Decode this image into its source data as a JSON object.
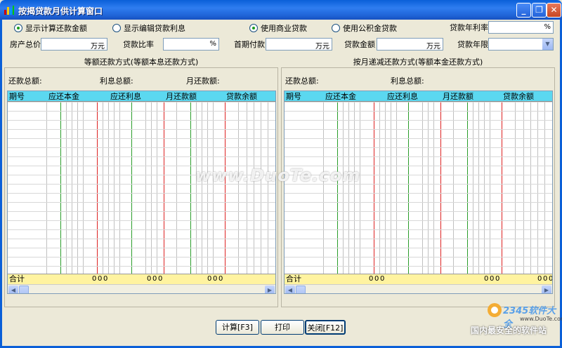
{
  "window": {
    "title": "按揭贷款月供计算窗口"
  },
  "options": {
    "show_total": "显示计算还款金额",
    "show_edit": "显示编辑贷款利息",
    "commercial": "使用商业贷款",
    "provident": "使用公积金贷款"
  },
  "fields": {
    "annual_rate_label": "贷款年利率",
    "annual_rate_unit": "%",
    "house_price_label": "房产总价",
    "house_price_unit": "万元",
    "loan_ratio_label": "贷款比率",
    "loan_ratio_unit": "%",
    "down_payment_label": "首期付款",
    "down_payment_unit": "万元",
    "loan_amount_label": "贷款金额",
    "loan_amount_unit": "万元",
    "loan_term_label": "贷款年限"
  },
  "left_panel": {
    "title": "等额还款方式(等额本息还款方式)",
    "total_repay": "还款总额:",
    "total_interest": "利息总额:",
    "monthly": "月还款额:",
    "columns": [
      "期号",
      "应还本金",
      "应还利息",
      "月还款额",
      "贷款余额"
    ],
    "footer": "合计",
    "zeros": [
      "0",
      "0",
      "0",
      "0",
      "0",
      "0",
      "0",
      "0",
      "0"
    ]
  },
  "right_panel": {
    "title": "按月递减还款方式(等额本金还款方式)",
    "total_repay": "还款总额:",
    "total_interest": "利息总额:",
    "columns": [
      "期号",
      "应还本金",
      "应还利息",
      "月还款额",
      "贷款余额"
    ],
    "footer": "合计",
    "zeros": [
      "0",
      "0",
      "0",
      "0",
      "0",
      "0",
      "0",
      "0",
      "0"
    ]
  },
  "buttons": {
    "calc": "计算[F3]",
    "print": "打印",
    "close": "关闭[F12]"
  },
  "watermark": {
    "text": "www.DuoTe.com",
    "brand": "2345软件大全",
    "url": "www.DuoTe.com",
    "slogan": "国内最安全的软件站"
  }
}
